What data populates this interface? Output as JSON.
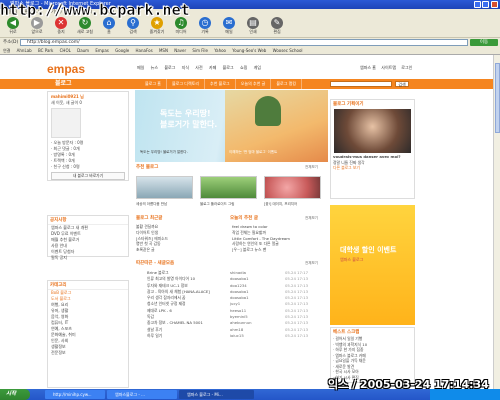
{
  "overlay": {
    "watermark": "http://www.bcpark.net",
    "timestamp": "익스 / 2005-03-24 17:14:34"
  },
  "window": {
    "title": "엠파스 블로그 - Microsoft Internet Explorer"
  },
  "menu": [
    "파일(F)",
    "편집(E)",
    "보기(V)",
    "즐겨찾기(A)",
    "도구(T)",
    "도움말(H)"
  ],
  "toolbar": [
    {
      "label": "뒤로",
      "icon": "back-arrow-icon",
      "color": "#2d8a2d"
    },
    {
      "label": "앞으로",
      "icon": "forward-arrow-icon",
      "color": "#8a8a8a"
    },
    {
      "label": "중지",
      "icon": "stop-icon",
      "color": "#d33"
    },
    {
      "label": "새로 고침",
      "icon": "refresh-icon",
      "color": "#2d8a2d"
    },
    {
      "label": "홈",
      "icon": "home-icon",
      "color": "#2a6ed0"
    },
    {
      "label": "검색",
      "icon": "search-icon",
      "color": "#2a6ed0"
    },
    {
      "label": "즐겨찾기",
      "icon": "star-icon",
      "color": "#e0a000"
    },
    {
      "label": "미디어",
      "icon": "media-icon",
      "color": "#2d8a2d"
    },
    {
      "label": "기록",
      "icon": "history-icon",
      "color": "#2a6ed0"
    },
    {
      "label": "메일",
      "icon": "mail-icon",
      "color": "#2a6ed0"
    },
    {
      "label": "인쇄",
      "icon": "print-icon",
      "color": "#555"
    },
    {
      "label": "편집",
      "icon": "edit-icon",
      "color": "#555"
    }
  ],
  "address": {
    "label": "주소(D)",
    "value": "http://blog.empas.com/",
    "go": "이동"
  },
  "links": [
    "연결",
    "AhnLab",
    "BC Park",
    "CHOL",
    "Daum",
    "Empas",
    "Google",
    "HanaFos",
    "MSN",
    "Naver",
    "Sim File",
    "Yahoo",
    "Young-Seo's Web",
    "Woosec School"
  ],
  "page": {
    "logo": "empas",
    "nav": [
      "메일",
      "뉴스",
      "블로그",
      "지식",
      "사전",
      "카페",
      "블로그",
      "쇼핑",
      "게임"
    ],
    "top_right": [
      "엠파스 홈",
      "사이트맵",
      "로그인"
    ],
    "section_title": "블로그",
    "tabs": [
      "블로그 홈",
      "블로그 디렉토리",
      "추천 블로그",
      "오늘의 추천 글",
      "블로그 랭킹"
    ],
    "search_button": "검색",
    "profile": {
      "name": "mahimi0921 님",
      "line1": "새 이웃, 새 글이 0",
      "stats": [
        "· 오늘 방문자 : 0명",
        "· 최근 댓글 : 0개",
        "· 방명록 : 0개",
        "· 트랙백 : 0개",
        "· 친구 신청 : 0명"
      ],
      "button": "내 블로그 바로가기"
    },
    "notice": {
      "title": "공지사항",
      "items": [
        "엠파스 블로그 새 개편",
        "DVD 무료 이벤트",
        "매월 추천 블로거",
        "사용 안내",
        "이벤트 당첨자",
        "필독 공지"
      ]
    },
    "category": {
      "title": "카테고리",
      "items": [
        "BoB 블로그",
        "도서 블로그",
        "여행, 요리",
        "유머, 생활",
        "음악, 영화",
        "컴퓨터, IT",
        "연예, 스포츠",
        "문화예술, 취미",
        "인문, 사회",
        "생활정보",
        "전문정보"
      ]
    },
    "banner": {
      "line1": "독도는 우리땅!",
      "line2": "블로거가 말한다.",
      "caption": "독도는 우리땅! 블로거가 말한다.",
      "side": "이해하는 '딴 엄마 블로그' 이벤트"
    },
    "recommend": {
      "title": "추천 블로그",
      "more": "전체보기",
      "items": [
        "세상의 아름다움 만남",
        "블로그 폴라로이드 그림",
        "[꽃!] 데이지, 프리지어"
      ]
    },
    "today": {
      "title": "블로그 최근글",
      "items": [
        "불황 견딜까요",
        "다이어트 인생",
        "[스타워즈] 에피소드",
        "명반 첫 곡 감동",
        "초록같은 글"
      ]
    },
    "today_posts": {
      "title": "오늘의 추천 글",
      "more": "전체보기",
      "items": [
        "feel drawn to color",
        "직업 전체는 필요할까",
        "Little Comfort - The Daydream",
        "사랑하는 연인의 또 다른 얼굴",
        "[우~] 블로그 뉴스 팬"
      ]
    },
    "new_posts": {
      "title": "따끈따끈 - 새글모음",
      "more": "전체보기",
      "rows": [
        {
          "t": "Brine 블로그",
          "u": "shinadia",
          "d": "05.24 17:17"
        },
        {
          "t": "인류 최고의 발명 아이디어 10",
          "u": "doosoba1",
          "d": "05.24 17:13"
        },
        {
          "t": "투자와 재테크 UC-1 정보",
          "u": "doo1234",
          "d": "05.24 17:13"
        },
        {
          "t": "광고 - 육아의 새 체험 [HANA-ALACE]",
          "u": "doosoba1",
          "d": "05.24 17:13"
        },
        {
          "t": "우리 생각 잠자리에서 꿈",
          "u": "doosoba1",
          "d": "05.24 17:13"
        },
        {
          "t": "청소년 인터넷 규정 제정",
          "u": "jucy1",
          "d": "05.24 17:13"
        },
        {
          "t": "제대로 LPK - 6",
          "u": "heeso11",
          "d": "05.24 17:13"
        },
        {
          "t": "독감",
          "u": "byemini5",
          "d": "05.24 17:13"
        },
        {
          "t": "중고차 정보 - CHAMEL NA 5001",
          "u": "ahebunnun",
          "d": "05.24 17:13"
        },
        {
          "t": "설날 후기",
          "u": "ohm18",
          "d": "05.24 17:13"
        },
        {
          "t": "하루 일기",
          "u": "ioiuc15",
          "d": "05.24 17:13"
        }
      ]
    },
    "right_top": {
      "title": "블로그 기획이기",
      "more": "전체보기",
      "caption": "voudrais-mus danser avec moi?",
      "sub": "정말 니들 진짜 생각",
      "more2": "다른 블로그 보기"
    },
    "ad": {
      "text": "대학생 할인 이벤트",
      "sub": "엠파스 블로그"
    },
    "best": {
      "title": "베스트 스크랩",
      "more": "전체보기",
      "items": [
        "· 걸어서 일일 기행",
        "· 빅뱅의 과학지식 10",
        "· 하루 한 가지 집중",
        "· 엠파스 블로그 카페",
        "· 금요일을 가득 채운",
        "· 새로운 발견",
        "· 한국 시사 모아",
        "· 여기 시사 편집",
        "· ??"
      ]
    },
    "recent": {
      "title": "블로그 최근",
      "more": "전체보기"
    }
  },
  "taskbar": {
    "start": "시작",
    "tasks": [
      "http://minihp.cyw...",
      "엠파스블로그 - ...",
      "엠파스 블로그 - Mi..."
    ]
  }
}
